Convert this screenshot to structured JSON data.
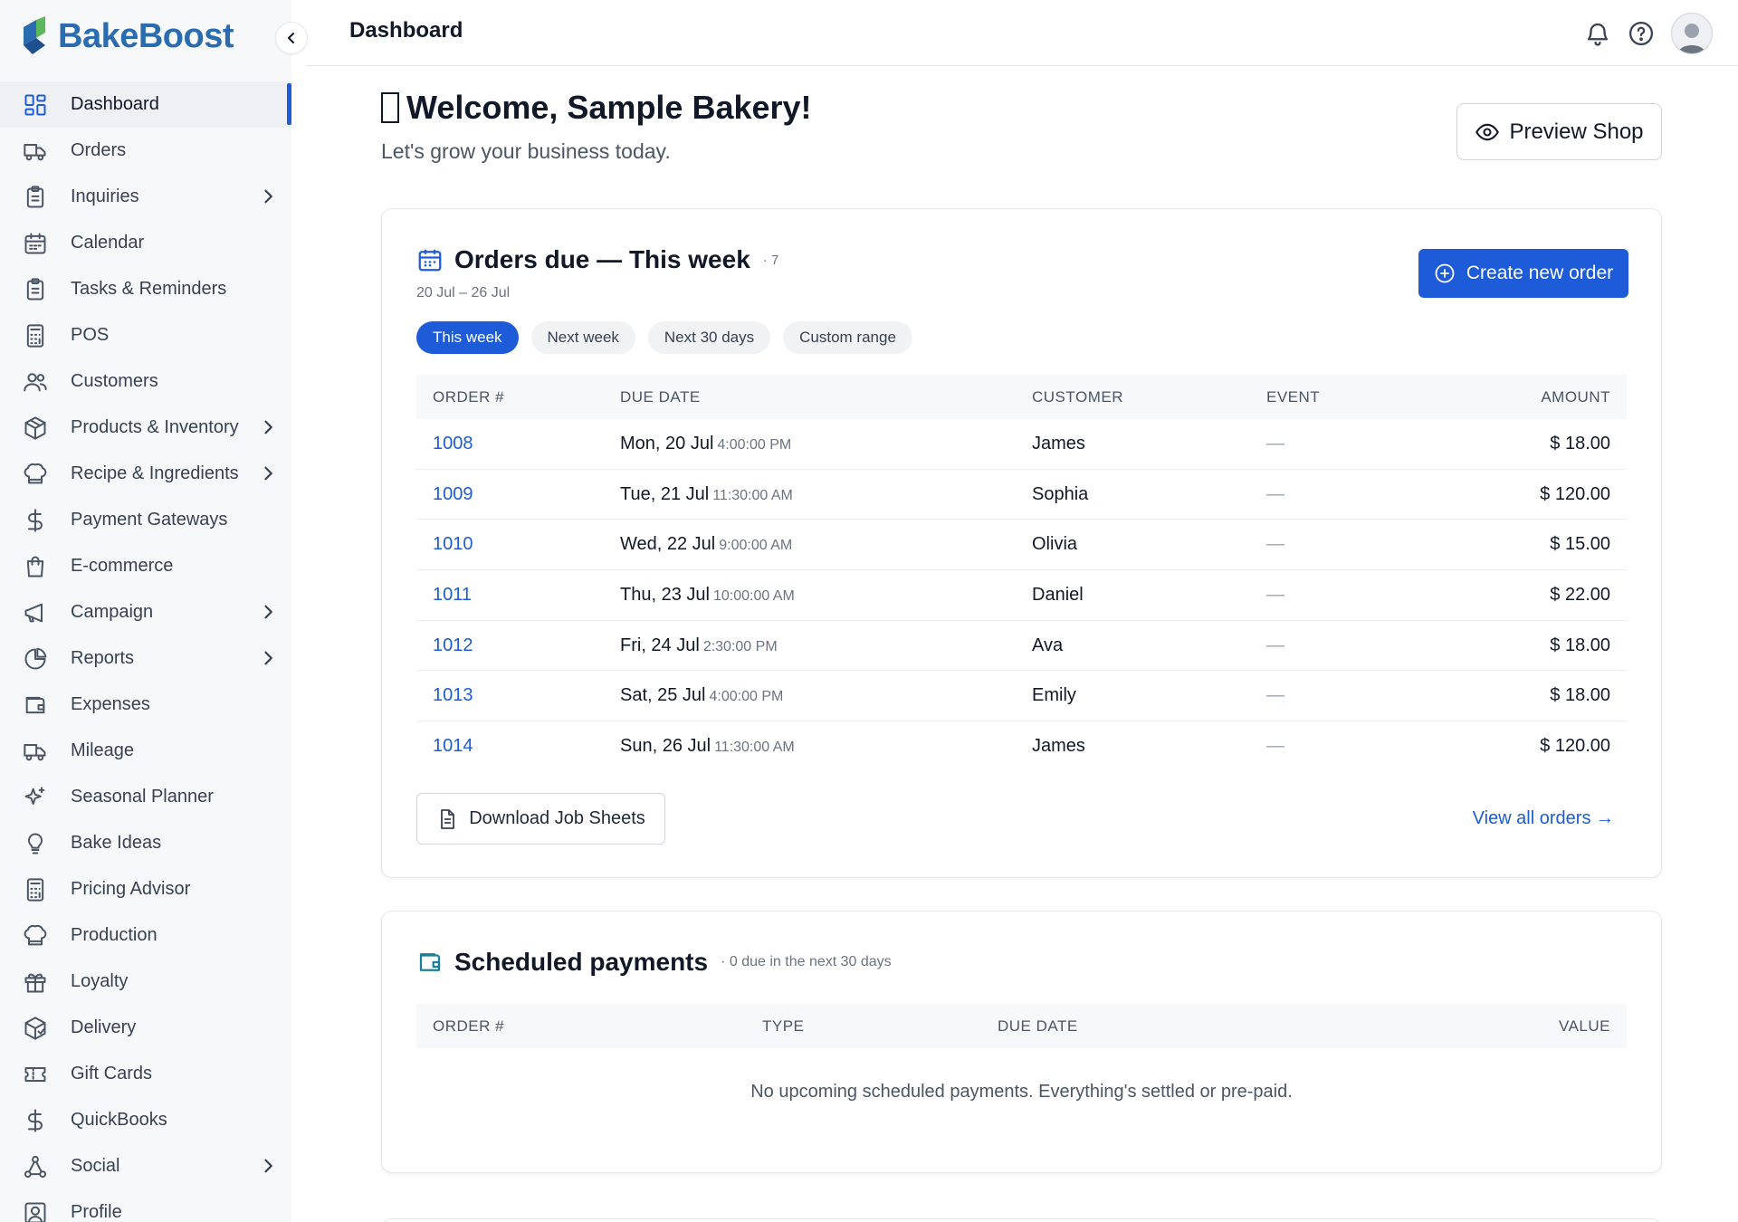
{
  "app": {
    "name": "BakeBoost",
    "brand_color": "#2b6cb0",
    "accent": "#1d5bd8"
  },
  "sidebar": {
    "items": [
      {
        "label": "Dashboard",
        "icon": "grid-icon",
        "active": true,
        "chevron": false
      },
      {
        "label": "Orders",
        "icon": "truck-icon",
        "chevron": false
      },
      {
        "label": "Inquiries",
        "icon": "clipboard-icon",
        "chevron": true
      },
      {
        "label": "Calendar",
        "icon": "calendar-icon",
        "chevron": false
      },
      {
        "label": "Tasks & Reminders",
        "icon": "clipboard-icon",
        "chevron": false
      },
      {
        "label": "POS",
        "icon": "calculator-icon",
        "chevron": false
      },
      {
        "label": "Customers",
        "icon": "users-icon",
        "chevron": false
      },
      {
        "label": "Products & Inventory",
        "icon": "box-icon",
        "chevron": true
      },
      {
        "label": "Recipe & Ingredients",
        "icon": "chef-hat-icon",
        "chevron": true
      },
      {
        "label": "Payment Gateways",
        "icon": "dollar-icon",
        "chevron": false
      },
      {
        "label": "E-commerce",
        "icon": "shopping-bag-icon",
        "chevron": false
      },
      {
        "label": "Campaign",
        "icon": "megaphone-icon",
        "chevron": true
      },
      {
        "label": "Reports",
        "icon": "pie-chart-icon",
        "chevron": true
      },
      {
        "label": "Expenses",
        "icon": "wallet-icon",
        "chevron": false
      },
      {
        "label": "Mileage",
        "icon": "truck-icon",
        "chevron": false
      },
      {
        "label": "Seasonal Planner",
        "icon": "sparkles-icon",
        "chevron": false
      },
      {
        "label": "Bake Ideas",
        "icon": "lightbulb-icon",
        "chevron": false
      },
      {
        "label": "Pricing Advisor",
        "icon": "calculator-icon",
        "chevron": false
      },
      {
        "label": "Production",
        "icon": "chef-hat-icon",
        "chevron": false
      },
      {
        "label": "Loyalty",
        "icon": "gift-icon",
        "chevron": false
      },
      {
        "label": "Delivery",
        "icon": "package-icon",
        "chevron": false
      },
      {
        "label": "Gift Cards",
        "icon": "ticket-icon",
        "chevron": false
      },
      {
        "label": "QuickBooks",
        "icon": "dollar-icon",
        "chevron": false
      },
      {
        "label": "Social",
        "icon": "share-icon",
        "chevron": true
      },
      {
        "label": "Profile",
        "icon": "user-square-icon",
        "chevron": false
      }
    ]
  },
  "header": {
    "title": "Dashboard"
  },
  "welcome": {
    "title": "Welcome, Sample Bakery!",
    "subtitle": "Let's grow your business today.",
    "preview_label": "Preview Shop"
  },
  "orders": {
    "title": "Orders due — This week",
    "count": "· 7",
    "range": "20 Jul – 26 Jul",
    "create_label": "Create new order",
    "chips": [
      "This week",
      "Next week",
      "Next 30 days",
      "Custom range"
    ],
    "columns": [
      "ORDER #",
      "DUE DATE",
      "CUSTOMER",
      "EVENT",
      "AMOUNT"
    ],
    "rows": [
      {
        "order": "1008",
        "date": "Mon, 20 Jul",
        "time": "4:00:00 PM",
        "customer": "James",
        "event": "—",
        "amount": "$ 18.00"
      },
      {
        "order": "1009",
        "date": "Tue, 21 Jul",
        "time": "11:30:00 AM",
        "customer": "Sophia",
        "event": "—",
        "amount": "$ 120.00"
      },
      {
        "order": "1010",
        "date": "Wed, 22 Jul",
        "time": "9:00:00 AM",
        "customer": "Olivia",
        "event": "—",
        "amount": "$ 15.00"
      },
      {
        "order": "1011",
        "date": "Thu, 23 Jul",
        "time": "10:00:00 AM",
        "customer": "Daniel",
        "event": "—",
        "amount": "$ 22.00"
      },
      {
        "order": "1012",
        "date": "Fri, 24 Jul",
        "time": "2:30:00 PM",
        "customer": "Ava",
        "event": "—",
        "amount": "$ 18.00"
      },
      {
        "order": "1013",
        "date": "Sat, 25 Jul",
        "time": "4:00:00 PM",
        "customer": "Emily",
        "event": "—",
        "amount": "$ 18.00"
      },
      {
        "order": "1014",
        "date": "Sun, 26 Jul",
        "time": "11:30:00 AM",
        "customer": "James",
        "event": "—",
        "amount": "$ 120.00"
      }
    ],
    "download_label": "Download Job Sheets",
    "view_all_label": "View all orders →"
  },
  "payments": {
    "title": "Scheduled payments",
    "summary": "· 0 due in the next 30 days",
    "columns": [
      "ORDER #",
      "TYPE",
      "DUE DATE",
      "VALUE"
    ],
    "empty_text": "No upcoming scheduled payments. Everything's settled or pre-paid."
  }
}
